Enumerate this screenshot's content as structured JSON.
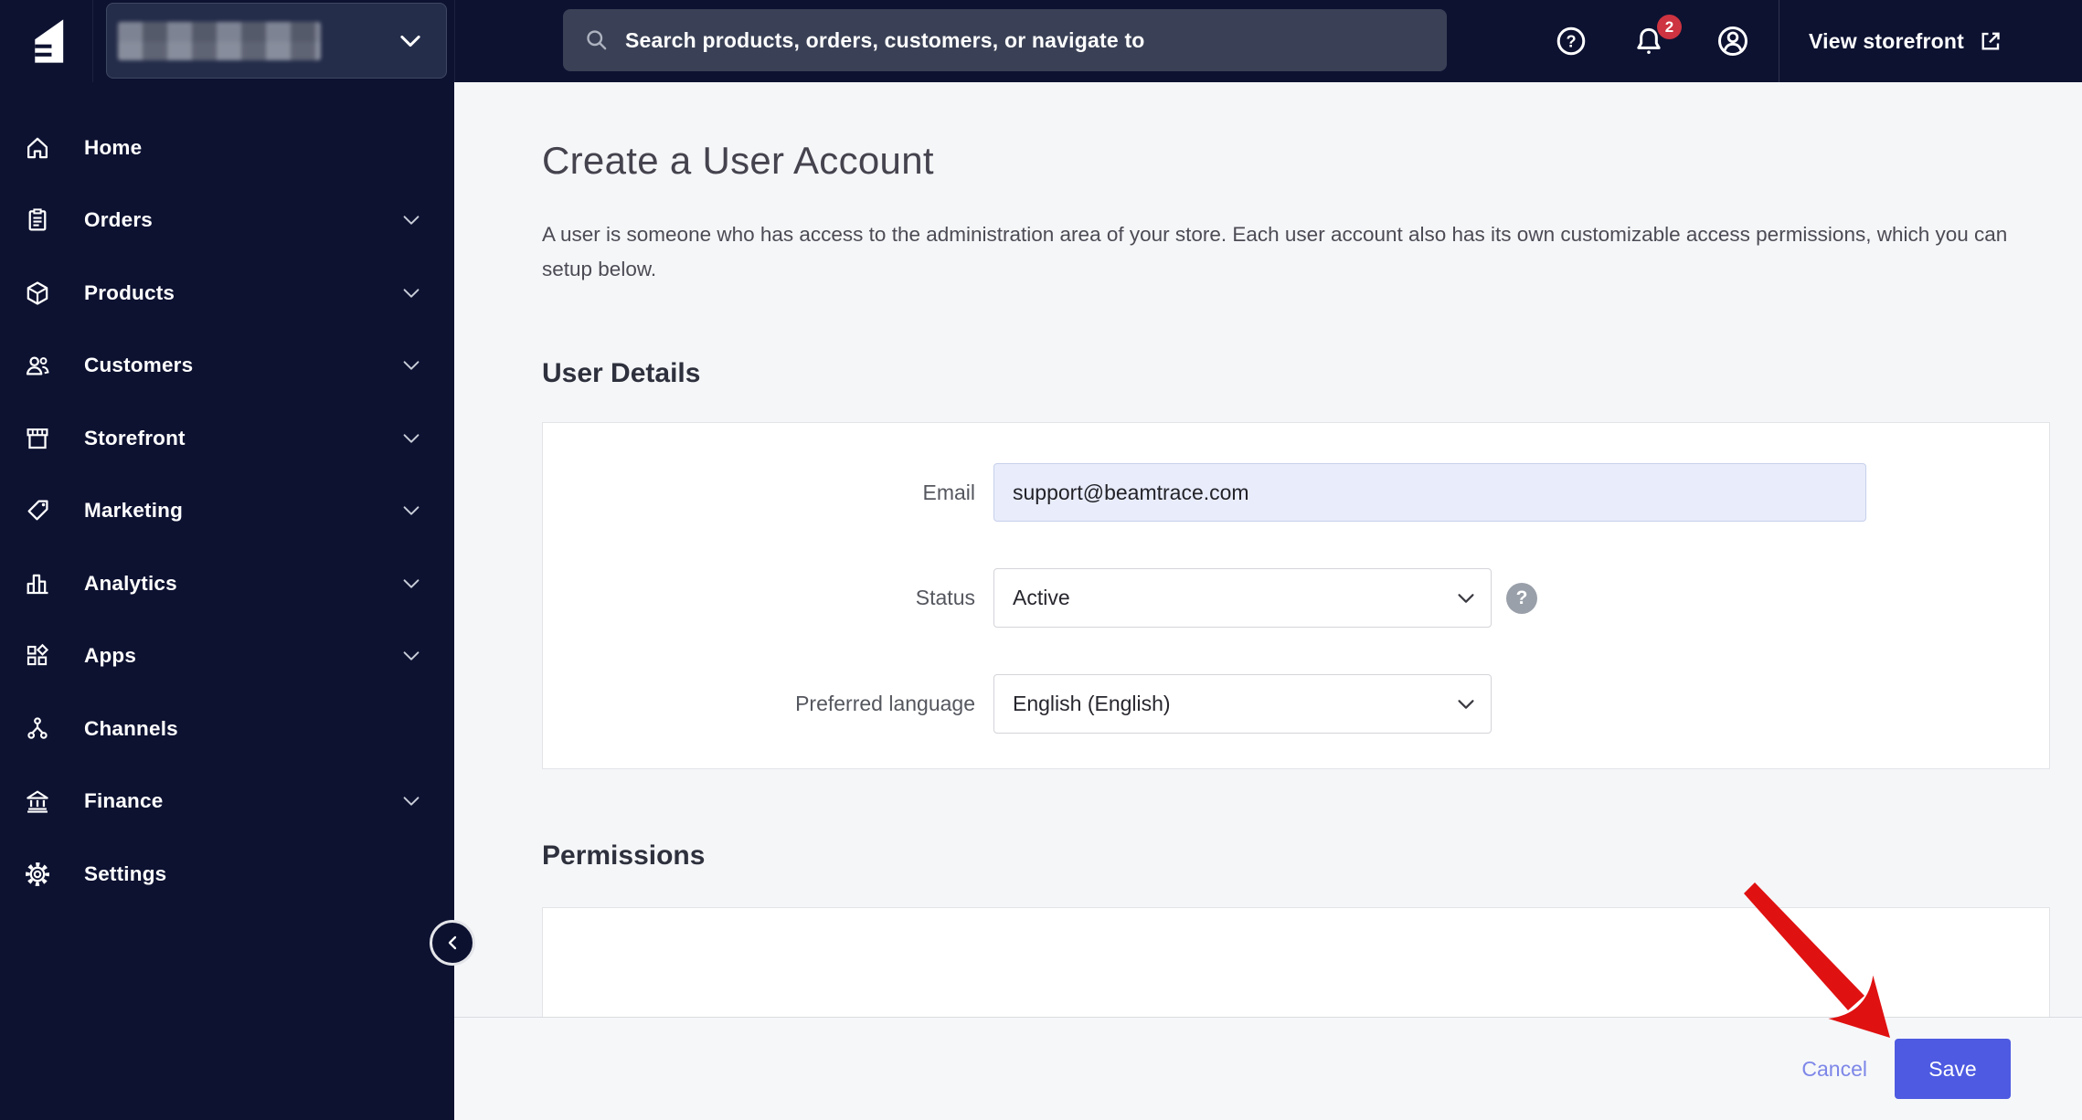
{
  "topbar": {
    "search_placeholder": "Search products, orders, customers, or navigate to",
    "notifications_badge": "2",
    "view_storefront_label": "View storefront",
    "help_glyph": "?"
  },
  "sidebar": {
    "items": [
      {
        "label": "Home",
        "icon": "home-icon",
        "expandable": false
      },
      {
        "label": "Orders",
        "icon": "orders-icon",
        "expandable": true
      },
      {
        "label": "Products",
        "icon": "products-icon",
        "expandable": true
      },
      {
        "label": "Customers",
        "icon": "customers-icon",
        "expandable": true
      },
      {
        "label": "Storefront",
        "icon": "storefront-icon",
        "expandable": true
      },
      {
        "label": "Marketing",
        "icon": "marketing-icon",
        "expandable": true
      },
      {
        "label": "Analytics",
        "icon": "analytics-icon",
        "expandable": true
      },
      {
        "label": "Apps",
        "icon": "apps-icon",
        "expandable": true
      },
      {
        "label": "Channels",
        "icon": "channels-icon",
        "expandable": false
      },
      {
        "label": "Finance",
        "icon": "finance-icon",
        "expandable": true
      },
      {
        "label": "Settings",
        "icon": "settings-icon",
        "expandable": false
      }
    ]
  },
  "page": {
    "title": "Create a User Account",
    "intro": "A user is someone who has access to the administration area of your store. Each user account also has its own customizable access permissions, which you can setup below."
  },
  "user_details": {
    "heading": "User Details",
    "fields": {
      "email": {
        "label": "Email",
        "value": "support@beamtrace.com"
      },
      "status": {
        "label": "Status",
        "value": "Active",
        "help_glyph": "?"
      },
      "language": {
        "label": "Preferred language",
        "value": "English (English)"
      }
    }
  },
  "permissions": {
    "heading": "Permissions"
  },
  "actions": {
    "cancel_label": "Cancel",
    "save_label": "Save"
  },
  "colors": {
    "sidebar_bg": "#0d1231",
    "accent": "#4d5ae1",
    "badge": "#cd3340",
    "email_field_bg": "#e9edfb",
    "arrow": "#e01111",
    "main_bg": "#f5f6f8"
  }
}
